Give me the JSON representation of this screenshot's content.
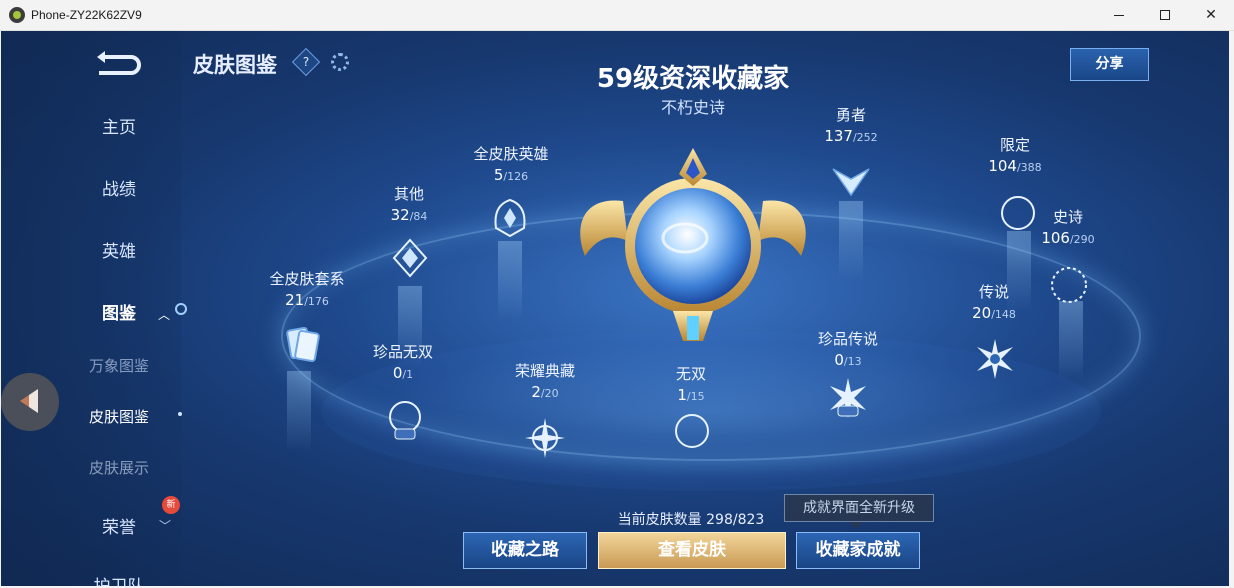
{
  "window": {
    "title": "Phone-ZY22K62ZV9"
  },
  "sidebar": {
    "items": [
      {
        "label": "主页"
      },
      {
        "label": "战绩"
      },
      {
        "label": "英雄"
      },
      {
        "label": "图鉴"
      },
      {
        "label": "万象图鉴"
      },
      {
        "label": "皮肤图鉴"
      },
      {
        "label": "皮肤展示"
      },
      {
        "label": "荣誉"
      },
      {
        "label": "护卫队"
      }
    ],
    "new_badge": "新"
  },
  "header": {
    "title": "皮肤图鉴",
    "help_symbol": "?",
    "share_label": "分享"
  },
  "rank": {
    "title": "59级资深收藏家",
    "subtitle": "不朽史诗"
  },
  "categories": [
    {
      "name": "全皮肤套系",
      "owned": "21",
      "total": "/176"
    },
    {
      "name": "其他",
      "owned": "32",
      "total": "/84"
    },
    {
      "name": "全皮肤英雄",
      "owned": "5",
      "total": "/126"
    },
    {
      "name": "勇者",
      "owned": "137",
      "total": "/252"
    },
    {
      "name": "限定",
      "owned": "104",
      "total": "/388"
    },
    {
      "name": "史诗",
      "owned": "106",
      "total": "/290"
    },
    {
      "name": "传说",
      "owned": "20",
      "total": "/148"
    },
    {
      "name": "珍品传说",
      "owned": "0",
      "total": "/13"
    },
    {
      "name": "无双",
      "owned": "1",
      "total": "/15"
    },
    {
      "name": "荣耀典藏",
      "owned": "2",
      "total": "/20"
    },
    {
      "name": "珍品无双",
      "owned": "0",
      "total": "/1"
    }
  ],
  "footer": {
    "collection_count": "当前皮肤数量 298/823",
    "tooltip": "成就界面全新升级",
    "buttons": {
      "road": "收藏之路",
      "view": "查看皮肤",
      "achievement": "收藏家成就"
    }
  },
  "colors": {
    "background": "#1f4a8e",
    "accent_blue": "#2c66b4",
    "gold": "#c99a54",
    "badge_red": "#e54a3a"
  }
}
